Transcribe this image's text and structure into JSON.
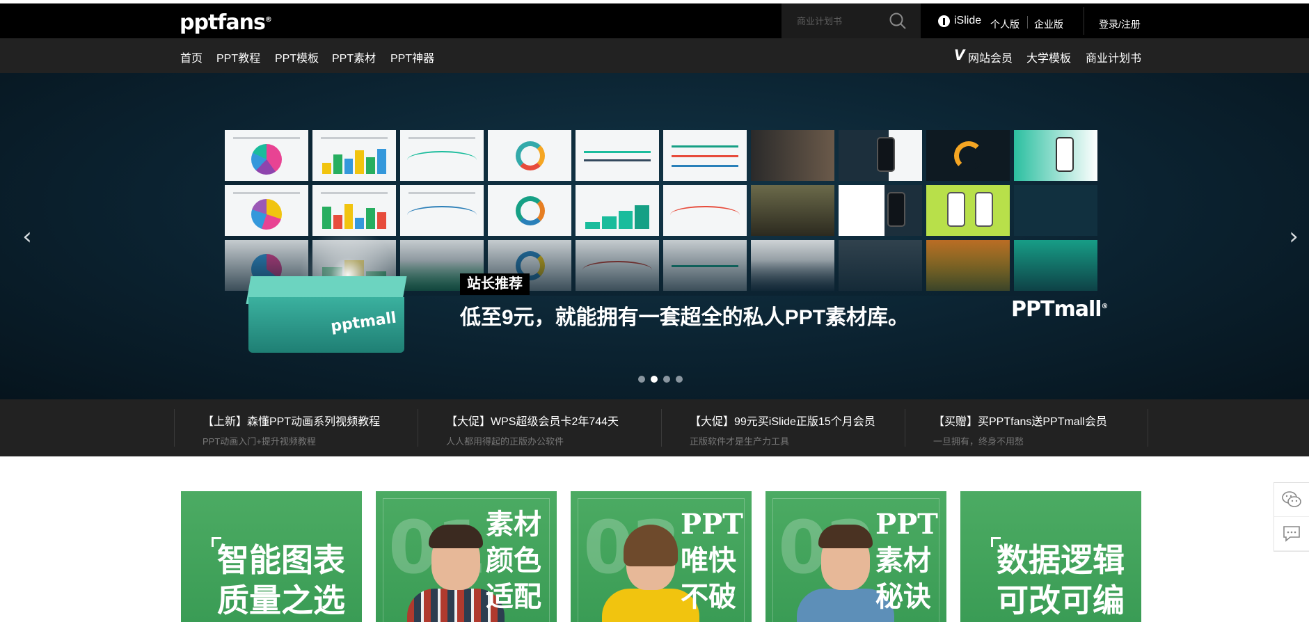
{
  "header": {
    "logo_text": "pptfans",
    "logo_mark": "®",
    "search_placeholder": "商业计划书",
    "islide_label": "iSlide",
    "personal_label": "个人版",
    "enterprise_label": "企业版",
    "login_label": "登录/注册"
  },
  "nav": {
    "left": [
      "首页",
      "PPT教程",
      "PPT模板",
      "PPT素材",
      "PPT神器"
    ],
    "right": [
      "网站会员",
      "大学模板",
      "商业计划书"
    ],
    "vip_mark": "V"
  },
  "banner": {
    "tag": "站长推荐",
    "headline": "低至9元，就能拥有一套超全的私人PPT素材库。",
    "box_logo": "pptmall",
    "brand_logo": "PPTmall",
    "brand_mark": "®",
    "prev_arrow": "‹",
    "next_arrow": "›",
    "slide_count": 4,
    "active_slide": 2
  },
  "news": [
    {
      "title": "【上新】森懂PPT动画系列视频教程",
      "sub": "PPT动画入门+提升视频教程"
    },
    {
      "title": "【大促】WPS超级会员卡2年744天",
      "sub": "人人都用得起的正版办公软件"
    },
    {
      "title": "【大促】99元买iSlide正版15个月会员",
      "sub": "正版软件才是生产力工具"
    },
    {
      "title": "【买赠】买PPTfans送PPTmall会员",
      "sub": "一旦拥有，终身不用愁"
    }
  ],
  "cards": [
    {
      "big_text": "智能图表质量之选"
    },
    {
      "num": "01",
      "v_text": "素材颜色适配"
    },
    {
      "num": "03",
      "v_text": "PPT唯快不破"
    },
    {
      "num": "02",
      "v_text": "PPT素材秘诀"
    },
    {
      "big_text": "数据逻辑可改可编"
    }
  ],
  "colors": {
    "topbar": "#000000",
    "navbar": "#222222",
    "banner_bg": "#0b2230",
    "card_green": "#43a55c",
    "box_teal": "#3bb19f"
  },
  "icons": {
    "search": "search-icon",
    "islide": "islide-icon",
    "vip": "vip-icon",
    "wechat": "wechat-icon",
    "chat": "chat-icon"
  }
}
